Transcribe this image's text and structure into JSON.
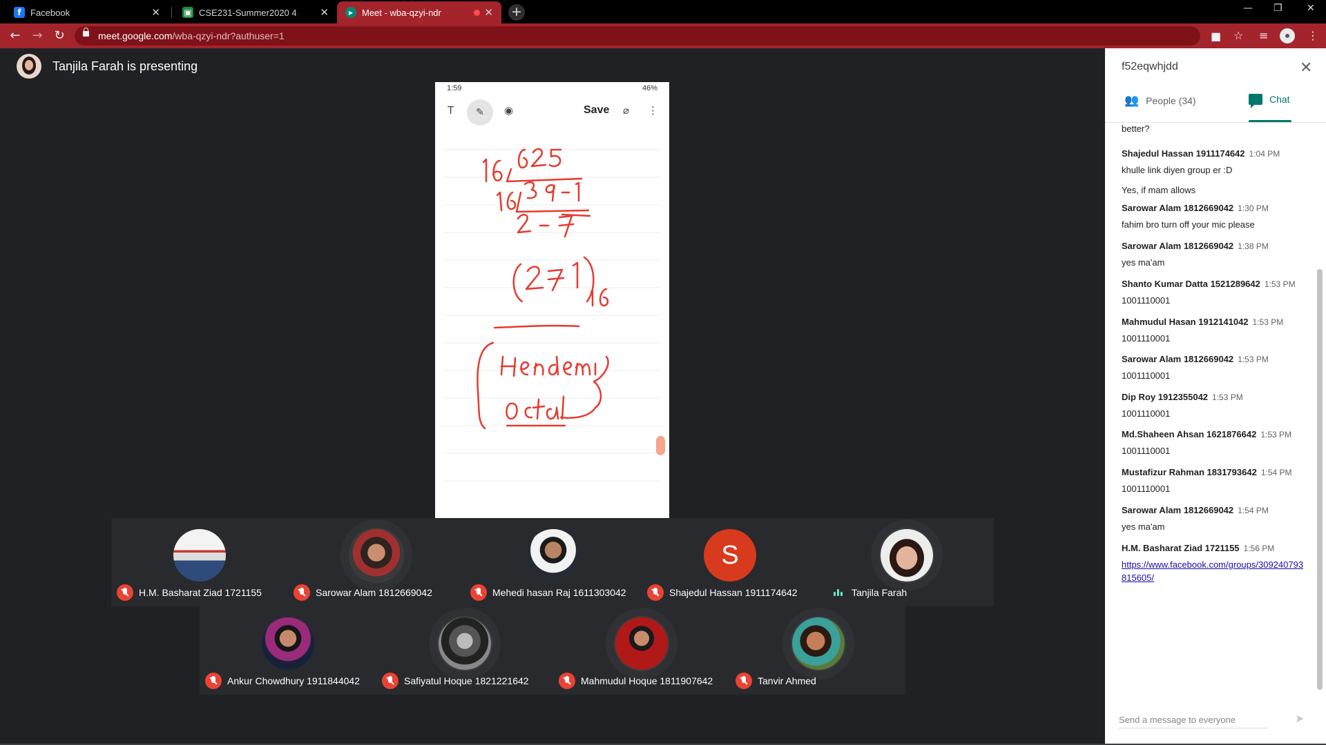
{
  "browser": {
    "tabs": [
      {
        "label": "Facebook",
        "favicon": "facebook-icon",
        "color": "#1877f2"
      },
      {
        "label": "CSE231-Summer2020 4",
        "favicon": "classroom-icon",
        "color": "#1e8e3e"
      },
      {
        "label": "Meet - wba-qzyi-ndr",
        "favicon": "meet-icon",
        "color": "#00897b",
        "recording": true
      }
    ],
    "url_host": "meet.google.com",
    "url_path": "/wba-qzyi-ndr?authuser=1",
    "accent": "#a4242b"
  },
  "presenter_text": "Tanjila Farah is presenting",
  "phone": {
    "status_time": "1:59",
    "status_right": "46%",
    "save_label": "Save"
  },
  "participants_row1": [
    {
      "name": "H.M. Basharat Ziad 1721155",
      "muted": true,
      "avatar": "photo"
    },
    {
      "name": "Sarowar Alam 1812669042",
      "muted": true,
      "avatar": "photo"
    },
    {
      "name": "Mehedi hasan Raj 1611303042",
      "muted": true,
      "avatar": "photo"
    },
    {
      "name": "Shajedul Hassan 1911174642",
      "muted": true,
      "avatar": "initial",
      "initial": "S"
    },
    {
      "name": "Tanjila Farah",
      "muted": false,
      "avatar": "photo",
      "speaking": true
    }
  ],
  "participants_row2": [
    {
      "name": "Ankur Chowdhury 1911844042",
      "muted": true
    },
    {
      "name": "Safiyatul Hoque 1821221642",
      "muted": true
    },
    {
      "name": "Mahmudul Hoque 1811907642",
      "muted": true
    },
    {
      "name": "Tanvir Ahmed",
      "muted": true
    }
  ],
  "panel": {
    "meeting_code": "f52eqwhjdd",
    "people_tab": "People (34)",
    "chat_tab": "Chat",
    "chat_accent": "#00796b",
    "partial_message": "better?",
    "messages": [
      {
        "who": "Shajedul Hassan 1911174642",
        "time": "1:04 PM",
        "lines": [
          "khulle link diyen group er :D",
          "Yes, if mam allows"
        ]
      },
      {
        "who": "Sarowar Alam 1812669042",
        "time": "1:30 PM",
        "lines": [
          "fahim bro turn off your mic please"
        ]
      },
      {
        "who": "Sarowar Alam 1812669042",
        "time": "1:38 PM",
        "lines": [
          "yes ma'am"
        ]
      },
      {
        "who": "Shanto Kumar Datta 1521289642",
        "time": "1:53 PM",
        "lines": [
          "1001110001"
        ]
      },
      {
        "who": "Mahmudul Hasan 1912141042",
        "time": "1:53 PM",
        "lines": [
          "1001110001"
        ]
      },
      {
        "who": "Sarowar Alam 1812669042",
        "time": "1:53 PM",
        "lines": [
          "1001110001"
        ]
      },
      {
        "who": "Dip Roy 1912355042",
        "time": "1:53 PM",
        "lines": [
          "1001110001"
        ]
      },
      {
        "who": "Md.Shaheen Ahsan 1621876642",
        "time": "1:53 PM",
        "lines": [
          "1001110001"
        ]
      },
      {
        "who": "Mustafizur Rahman 1831793642",
        "time": "1:54 PM",
        "lines": [
          "1001110001"
        ]
      },
      {
        "who": "Sarowar Alam 1812669042",
        "time": "1:54 PM",
        "lines": [
          "yes ma'am"
        ]
      },
      {
        "who": "H.M. Basharat Ziad 1721155",
        "time": "1:56 PM",
        "lines": [
          "https://www.facebook.com/groups/309240793815605/"
        ],
        "link": true
      }
    ],
    "composer_placeholder": "Send a message to everyone"
  }
}
